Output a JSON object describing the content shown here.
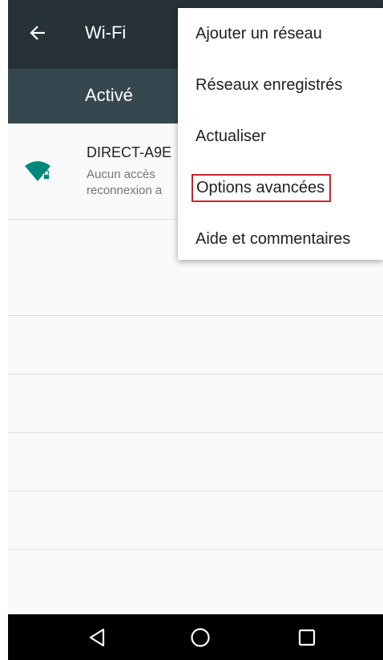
{
  "appbar": {
    "title": "Wi-Fi",
    "back_icon": "arrow-back-icon",
    "color": "#263238"
  },
  "master_switch": {
    "label": "Activé",
    "color": "#37474f"
  },
  "networks": [
    {
      "name": "DIRECT-A9E",
      "status_line1": "Aucun accès",
      "status_line2": "reconnexion a",
      "icon": "wifi-locked-icon",
      "icon_color": "#00897b"
    }
  ],
  "overflow_menu": {
    "items": [
      {
        "label": "Ajouter un réseau"
      },
      {
        "label": "Réseaux enregistrés"
      },
      {
        "label": "Actualiser"
      },
      {
        "label": "Options avancées",
        "highlighted": true
      },
      {
        "label": "Aide et commentaires"
      }
    ],
    "highlight_color": "#d0212b"
  },
  "navbar": {
    "buttons": [
      "back-triangle-icon",
      "home-circle-icon",
      "recents-square-icon"
    ]
  }
}
